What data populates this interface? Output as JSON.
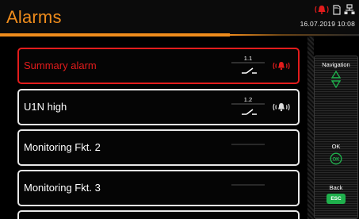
{
  "header": {
    "title": "Alarms",
    "datetime": "16.07.2019 10:08",
    "status_icons": [
      "alarm-bell-icon",
      "sd-card-icon",
      "network-icon"
    ]
  },
  "alarms": [
    {
      "label": "Summary alarm",
      "contact_number": "1.1",
      "state": "active",
      "bell": true
    },
    {
      "label": "U1N high",
      "contact_number": "1.2",
      "state": "inactive",
      "bell": true
    },
    {
      "label": "Monitoring Fkt. 2",
      "contact_number": "",
      "state": "none",
      "bell": false
    },
    {
      "label": "Monitoring Fkt. 3",
      "contact_number": "",
      "state": "none",
      "bell": false
    }
  ],
  "navigation": {
    "navigation_label": "Navigation",
    "ok_label": "OK",
    "ok_key": "OK",
    "back_label": "Back",
    "back_key": "ESC"
  },
  "colors": {
    "accent_orange": "#ef8c1c",
    "alarm_red": "#e21c1c",
    "key_green": "#1fb04c"
  }
}
